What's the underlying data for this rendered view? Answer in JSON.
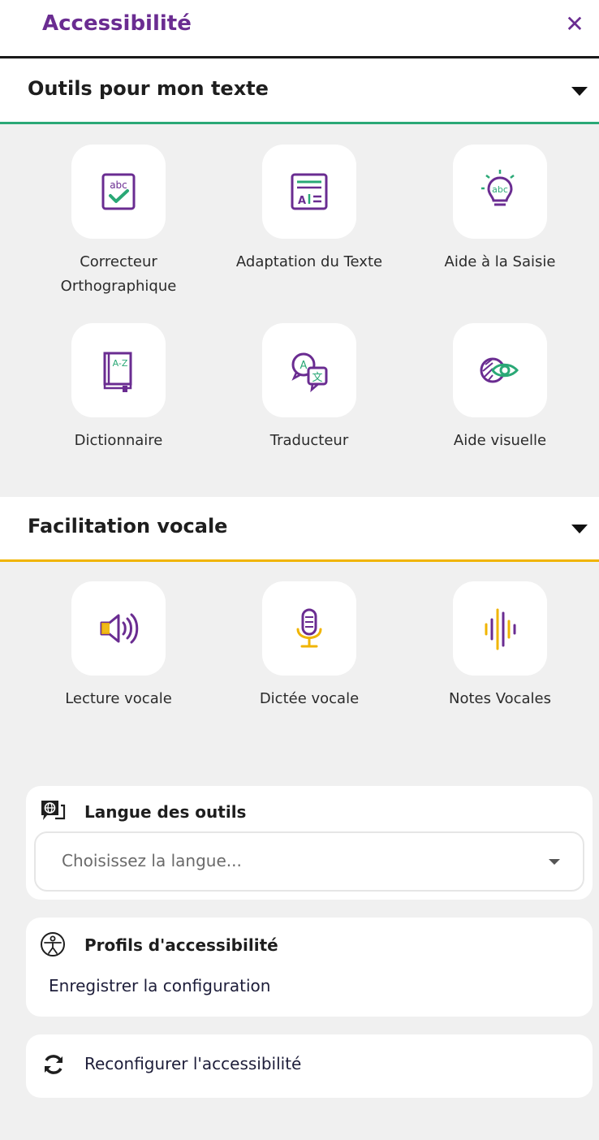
{
  "header": {
    "title": "Accessibilité",
    "close_label": "✕"
  },
  "text_tools": {
    "title": "Outils pour mon texte",
    "accent_color": "#2aa876",
    "items": [
      {
        "label": "Correcteur Orthographique",
        "icon": "spellcheck-icon"
      },
      {
        "label": "Adaptation du Texte",
        "icon": "text-adapt-icon"
      },
      {
        "label": "Aide à la Saisie",
        "icon": "lightbulb-abc-icon"
      },
      {
        "label": "Dictionnaire",
        "icon": "dictionary-icon"
      },
      {
        "label": "Traducteur",
        "icon": "translate-icon"
      },
      {
        "label": "Aide visuelle",
        "icon": "visual-aid-icon"
      }
    ]
  },
  "voice_tools": {
    "title": "Facilitation vocale",
    "accent_color": "#f0b400",
    "items": [
      {
        "label": "Lecture vocale",
        "icon": "speaker-icon"
      },
      {
        "label": "Dictée vocale",
        "icon": "microphone-icon"
      },
      {
        "label": "Notes Vocales",
        "icon": "waveform-icon"
      }
    ]
  },
  "language": {
    "title": "Langue des outils",
    "placeholder": "Choisissez la langue..."
  },
  "profiles": {
    "title": "Profils d'accessibilité",
    "link": "Enregistrer la configuration"
  },
  "reset": {
    "label": "Reconfigurer l'accessibilité"
  },
  "colors": {
    "brand_purple": "#6a2c91",
    "green": "#2aa876",
    "orange": "#f0b400"
  }
}
